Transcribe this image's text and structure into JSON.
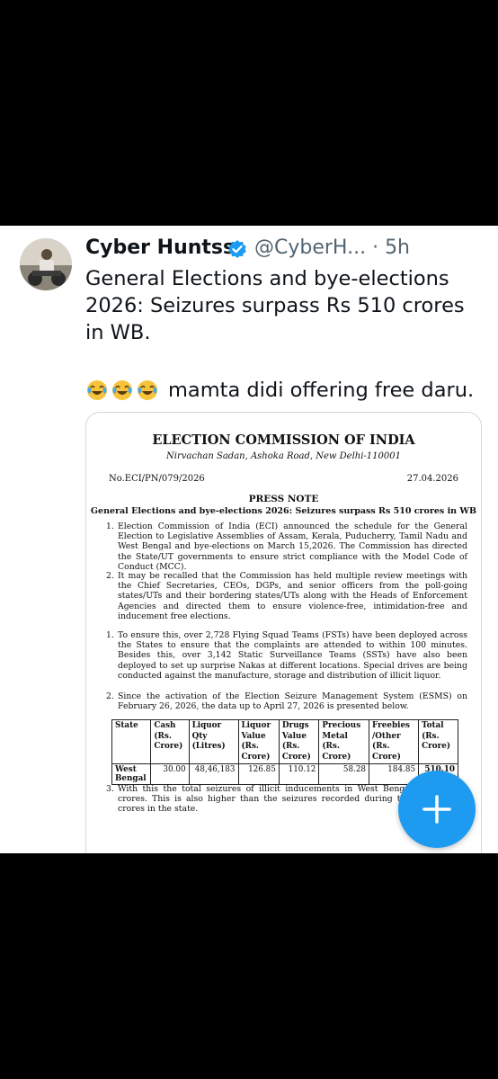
{
  "tweet": {
    "display_name": "Cyber Huntss",
    "handle": "@CyberH...",
    "separator": "·",
    "time": "5h",
    "text": "General Elections and bye-elections 2026: Seizures surpass Rs 510 crores in WB.",
    "comment": "mamta didi offering free daru.",
    "emojis": [
      "laughing-tears-emoji",
      "laughing-tears-emoji",
      "laughing-tears-emoji"
    ]
  },
  "document": {
    "title": "ELECTION COMMISSION OF INDIA",
    "address": "Nirvachan Sadan, Ashoka Road, New Delhi-110001",
    "ref_no": "No.ECI/PN/079/2026",
    "date": "27.04.2026",
    "heading": "PRESS NOTE",
    "subheading": "General Elections and bye-elections 2026: Seizures surpass Rs 510 crores in WB",
    "paragraphs": [
      {
        "num": "1.",
        "text": "Election Commission of India (ECI) announced the schedule for the General Election to Legislative Assemblies of Assam, Kerala, Puducherry, Tamil Nadu and West Bengal and bye-elections on March 15,2026. The Commission has directed the State/UT governments to ensure strict compliance with the Model Code of Conduct (MCC)."
      },
      {
        "num": "2.",
        "text": "It may be recalled that the Commission has held multiple review meetings with the Chief Secretaries, CEOs, DGPs, and senior officers from the poll-going states/UTs and their bordering states/UTs along with the Heads of Enforcement Agencies and directed them to ensure violence-free, intimidation-free and inducement free elections."
      },
      {
        "num": "1.",
        "text": "To ensure this, over 2,728 Flying Squad Teams (FSTs) have been deployed across the States to ensure that the complaints are attended to within 100 minutes. Besides this, over 3,142 Static Surveillance Teams (SSTs) have also been deployed to set up surprise Nakas at different locations. Special drives are being conducted against the manufacture, storage and distribution of illicit liquor."
      },
      {
        "num": "2.",
        "text": "Since the activation of the Election Seizure Management System (ESMS) on February 26, 2026, the data up to April 27, 2026 is presented below."
      },
      {
        "num": "3.",
        "text": "With this the total seizures of illicit inducements in West Bengal has su 510 crores. This is also higher than the seizures recorded during th with Rs. 339 crores in the state."
      }
    ],
    "table": {
      "headers": [
        "State",
        "Cash (Rs. Crore)",
        "Liquor Qty (Litres)",
        "Liquor Value (Rs. Crore)",
        "Drugs Value (Rs. Crore)",
        "Precious Metal (Rs. Crore)",
        "Freebies /Other (Rs. Crore)",
        "Total (Rs. Crore)"
      ],
      "rows": [
        [
          "West Bengal",
          "30.00",
          "48,46,183",
          "126.85",
          "110.12",
          "58.28",
          "184.85",
          "510.10"
        ]
      ]
    }
  },
  "fab": {
    "icon": "plus-icon",
    "color": "#1d9bf0"
  },
  "colors": {
    "accent": "#1d9bf0",
    "text": "#0f1419",
    "muted": "#536471"
  }
}
